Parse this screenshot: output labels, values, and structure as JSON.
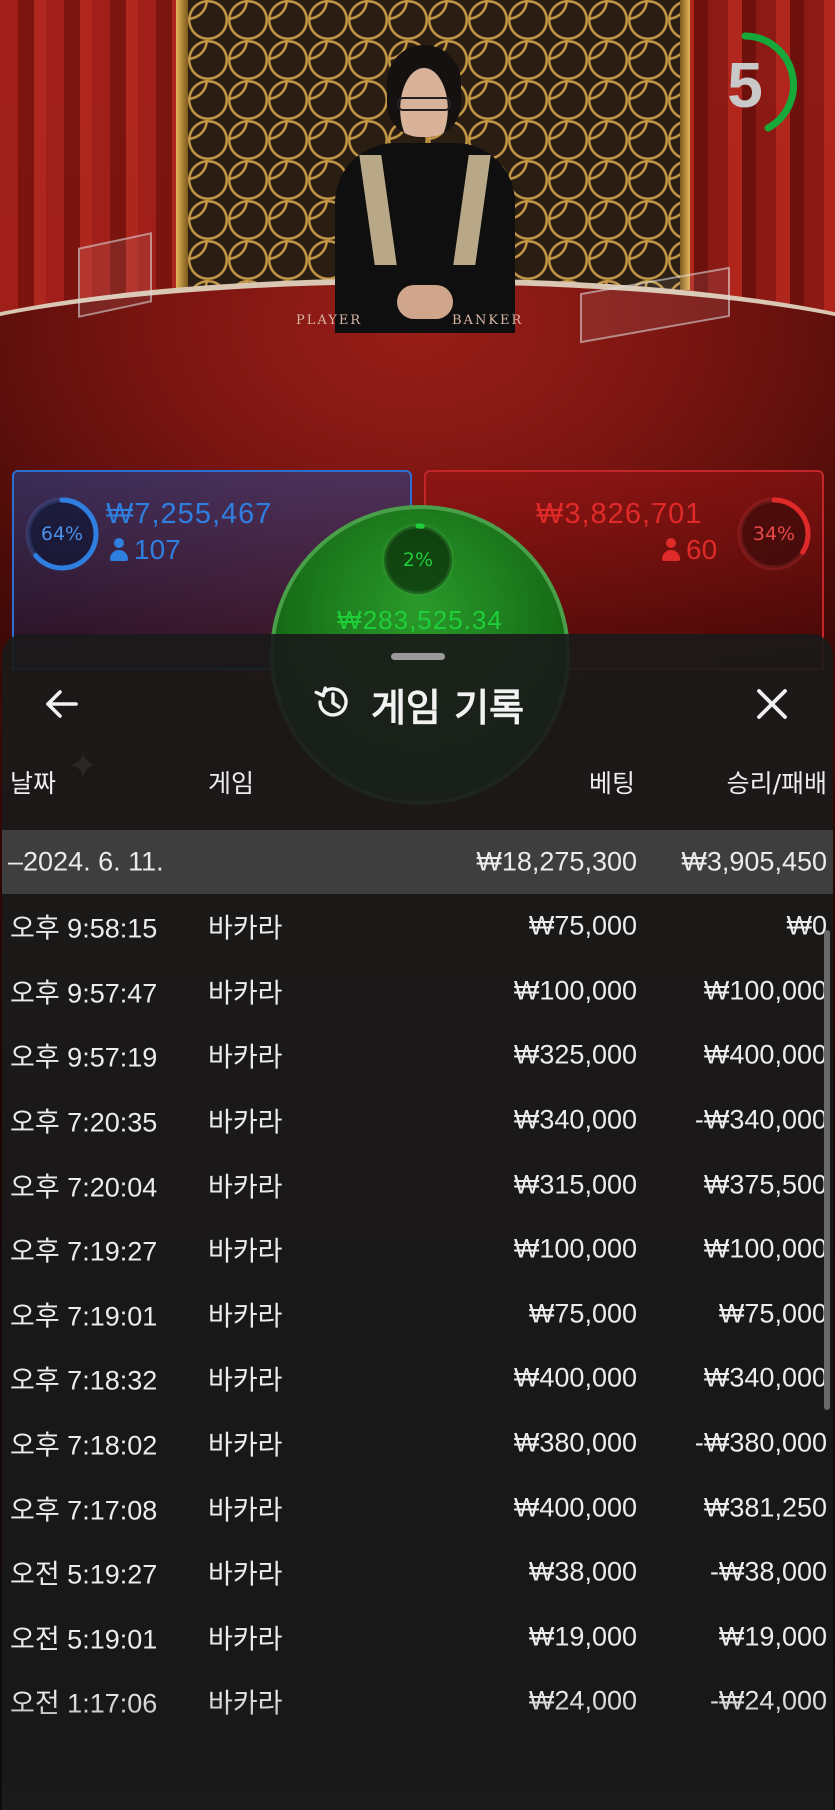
{
  "live_table": {
    "countdown": "5",
    "felt_labels": {
      "player": "PLAYER",
      "banker": "BANKER"
    },
    "player": {
      "percent_label": "64%",
      "percent": 64,
      "amount": "₩7,255,467",
      "count": "107",
      "color": "#2f7fe0"
    },
    "banker": {
      "percent_label": "34%",
      "percent": 34,
      "amount": "₩3,826,701",
      "count": "60",
      "color": "#e02a2a"
    },
    "tie": {
      "percent_label": "2%",
      "percent": 2,
      "amount": "₩283,525.34",
      "color": "#1fcf3a"
    }
  },
  "history": {
    "title": "게임 기록",
    "icons": {
      "back": "arrow-left-icon",
      "title": "history-clock-icon",
      "close": "close-icon"
    },
    "columns": {
      "date": "날짜",
      "game": "게임",
      "bet": "베팅",
      "result": "승리/패배"
    },
    "summary": {
      "date": "–2024. 6. 11.",
      "bet": "₩18,275,300",
      "result": "₩3,905,450"
    },
    "rows": [
      {
        "time": "오후 9:58:15",
        "game": "바카라",
        "bet": "₩75,000",
        "result": "₩0"
      },
      {
        "time": "오후 9:57:47",
        "game": "바카라",
        "bet": "₩100,000",
        "result": "₩100,000"
      },
      {
        "time": "오후 9:57:19",
        "game": "바카라",
        "bet": "₩325,000",
        "result": "₩400,000"
      },
      {
        "time": "오후 7:20:35",
        "game": "바카라",
        "bet": "₩340,000",
        "result": "-₩340,000"
      },
      {
        "time": "오후 7:20:04",
        "game": "바카라",
        "bet": "₩315,000",
        "result": "₩375,500"
      },
      {
        "time": "오후 7:19:27",
        "game": "바카라",
        "bet": "₩100,000",
        "result": "₩100,000"
      },
      {
        "time": "오후 7:19:01",
        "game": "바카라",
        "bet": "₩75,000",
        "result": "₩75,000"
      },
      {
        "time": "오후 7:18:32",
        "game": "바카라",
        "bet": "₩400,000",
        "result": "₩340,000"
      },
      {
        "time": "오후 7:18:02",
        "game": "바카라",
        "bet": "₩380,000",
        "result": "-₩380,000"
      },
      {
        "time": "오후 7:17:08",
        "game": "바카라",
        "bet": "₩400,000",
        "result": "₩381,250"
      },
      {
        "time": "오전 5:19:27",
        "game": "바카라",
        "bet": "₩38,000",
        "result": "-₩38,000"
      },
      {
        "time": "오전 5:19:01",
        "game": "바카라",
        "bet": "₩19,000",
        "result": "₩19,000"
      },
      {
        "time": "오전 1:17:06",
        "game": "바카라",
        "bet": "₩24,000",
        "result": "-₩24,000"
      }
    ]
  }
}
